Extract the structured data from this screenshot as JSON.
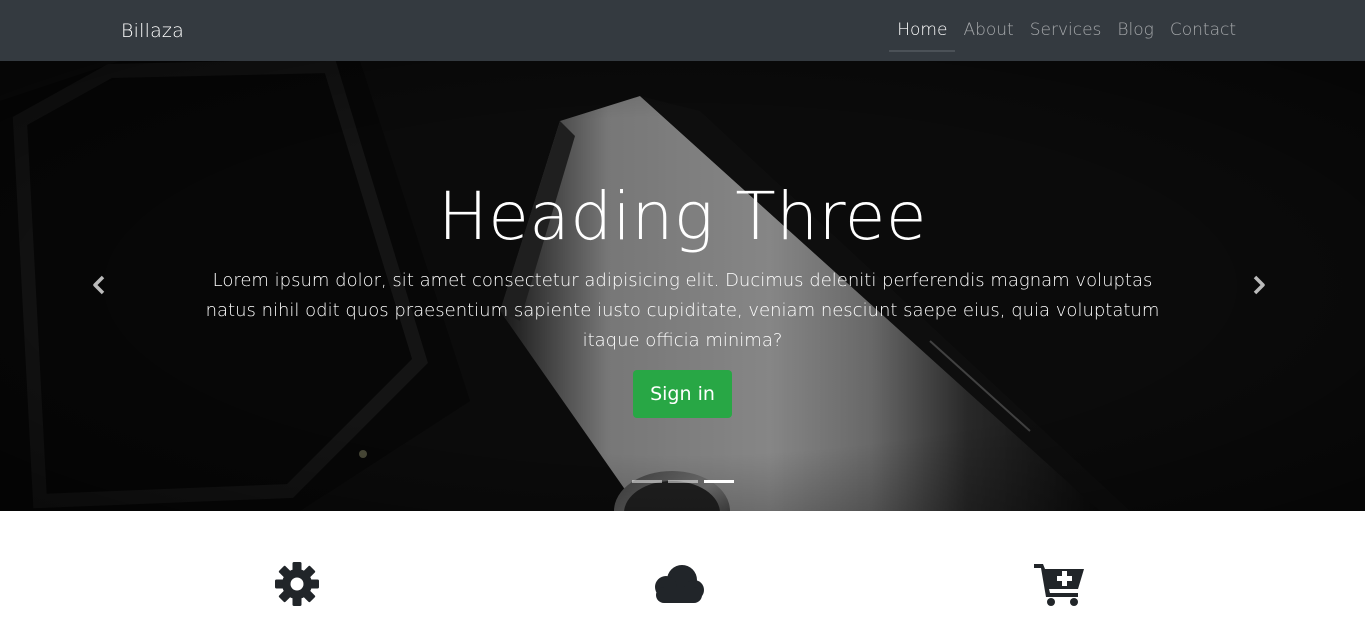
{
  "navbar": {
    "brand": "Billaza",
    "links": [
      {
        "label": "Home",
        "active": true
      },
      {
        "label": "About",
        "active": false
      },
      {
        "label": "Services",
        "active": false
      },
      {
        "label": "Blog",
        "active": false
      },
      {
        "label": "Contact",
        "active": false
      }
    ]
  },
  "carousel": {
    "heading": "Heading Three",
    "text": "Lorem ipsum dolor, sit amet consectetur adipisicing elit. Ducimus deleniti perferendis magnam voluptas natus nihil odit quos praesentium sapiente iusto cupiditate, veniam nesciunt saepe eius, quia voluptatum itaque officia minima?",
    "button_label": "Sign in",
    "prev_icon": "chevron-left-icon",
    "next_icon": "chevron-right-icon",
    "slide_count": 3,
    "active_slide": 3
  },
  "features": [
    {
      "icon": "gear-icon"
    },
    {
      "icon": "cloud-icon"
    },
    {
      "icon": "cart-plus-icon"
    }
  ],
  "colors": {
    "navbar_bg": "#343a40",
    "button_bg": "#28a745",
    "icon_color": "#212529"
  }
}
